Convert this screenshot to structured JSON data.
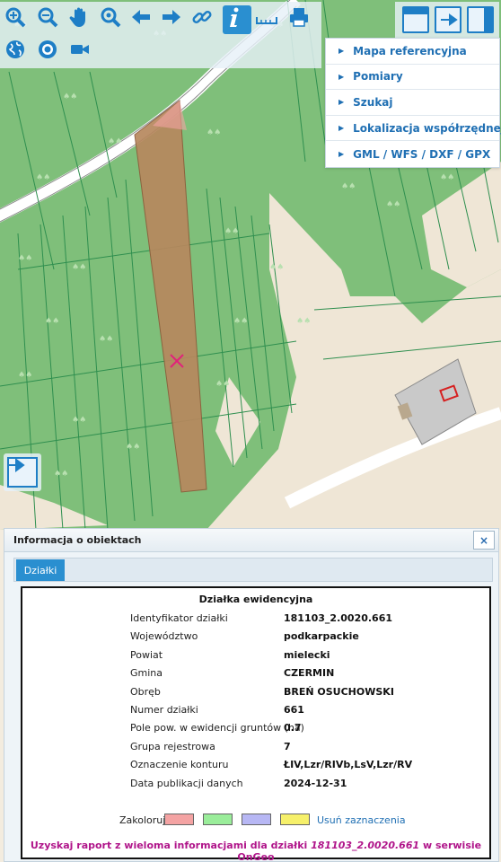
{
  "toolbar": {
    "buttons": [
      {
        "icon": "zoom-in-icon"
      },
      {
        "icon": "zoom-out-icon"
      },
      {
        "icon": "pan-hand-icon"
      },
      {
        "icon": "zoom-extent-icon"
      },
      {
        "icon": "back-arrow-icon"
      },
      {
        "icon": "forward-arrow-icon"
      },
      {
        "icon": "link-icon"
      },
      {
        "icon": "info-icon",
        "active": true
      },
      {
        "icon": "measure-ruler-icon"
      },
      {
        "icon": "print-icon"
      },
      {
        "icon": "globe-icon"
      },
      {
        "icon": "locate-target-icon"
      },
      {
        "icon": "video-camera-icon"
      }
    ]
  },
  "menu": {
    "items": [
      {
        "label": "Mapa referencyjna"
      },
      {
        "label": "Pomiary"
      },
      {
        "label": "Szukaj"
      },
      {
        "label": "Lokalizacja współrzędnej"
      },
      {
        "label": "GML / WFS / DXF / GPX"
      }
    ]
  },
  "panel": {
    "title": "Informacja o obiektach",
    "close_label": "×",
    "tab_label": "Działki",
    "heading": "Działka ewidencyjna",
    "fields": [
      {
        "label": "Identyfikator działki",
        "value": "181103_2.0020.661"
      },
      {
        "label": "Województwo",
        "value": "podkarpackie"
      },
      {
        "label": "Powiat",
        "value": "mielecki"
      },
      {
        "label": "Gmina",
        "value": "CZERMIN"
      },
      {
        "label": "Obręb",
        "value": "BREŃ OSUCHOWSKI"
      },
      {
        "label": "Numer działki",
        "value": "661"
      },
      {
        "label": "Pole pow. w ewidencji gruntów (ha)",
        "value": "0.7"
      },
      {
        "label": "Grupa rejestrowa",
        "value": "7"
      },
      {
        "label": "Oznaczenie konturu",
        "value": "ŁIV,Lzr/RIVb,LsV,Lzr/RV"
      },
      {
        "label": "Data publikacji danych",
        "value": "2024-12-31"
      }
    ],
    "colorize_label": "Zakoloruj:",
    "colors": [
      "#f4a3a3",
      "#9aed9a",
      "#b7b7f4",
      "#f6f06a"
    ],
    "clear_label": "Usuń zaznaczenia",
    "report_prefix": "Uzyskaj raport z wieloma informacjami dla działki ",
    "report_id": "181103_2.0020.661",
    "report_suffix": " w serwisie OnGeo"
  },
  "colors": {
    "accent": "#2a8fd0",
    "forest": "#7fbf7a",
    "parcel": "#b7885e",
    "report": "#b0158a"
  }
}
